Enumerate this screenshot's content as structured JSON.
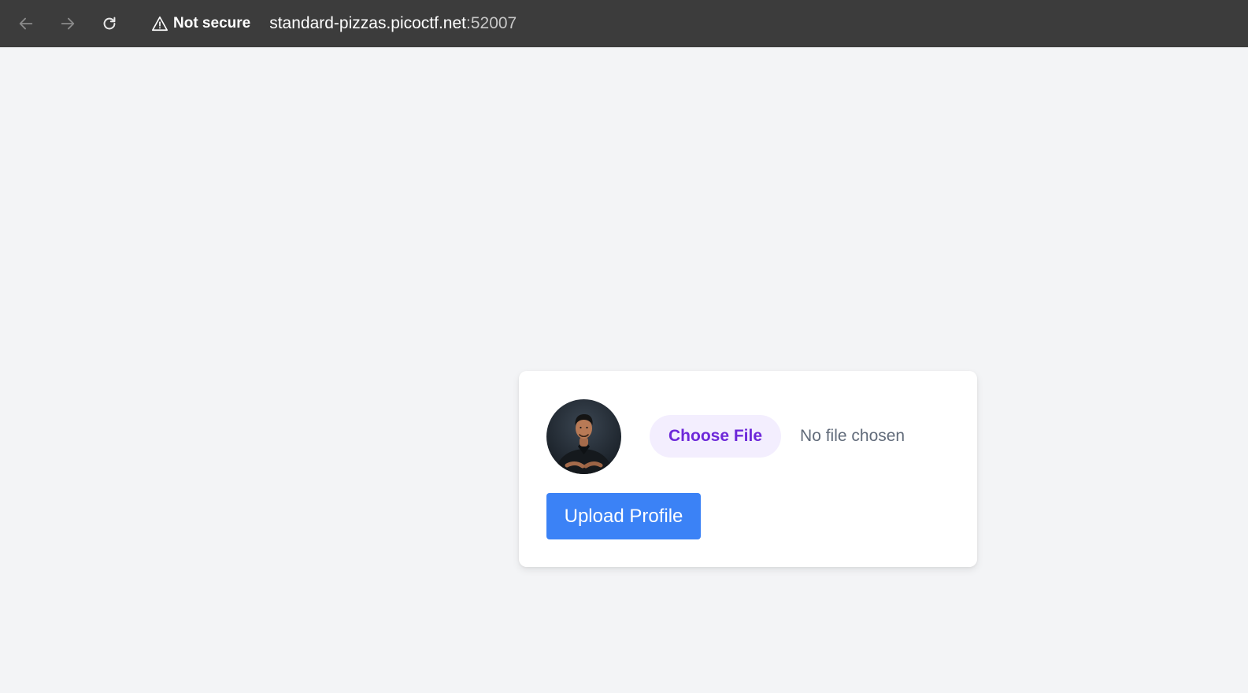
{
  "browser": {
    "security_label": "Not secure",
    "url_host": "standard-pizzas.picoctf.net",
    "url_port": ":52007",
    "icons": {
      "back": "arrow-left-icon",
      "forward": "arrow-right-icon",
      "reload": "reload-icon",
      "security": "warning-triangle-icon"
    }
  },
  "profile_form": {
    "choose_file_label": "Choose File",
    "file_status": "No file chosen",
    "upload_label": "Upload Profile",
    "colors": {
      "page_background": "#f3f4f6",
      "upload_button": "#3b82f6",
      "choose_file_background": "#f3eefe",
      "choose_file_text": "#6d28d9"
    }
  }
}
